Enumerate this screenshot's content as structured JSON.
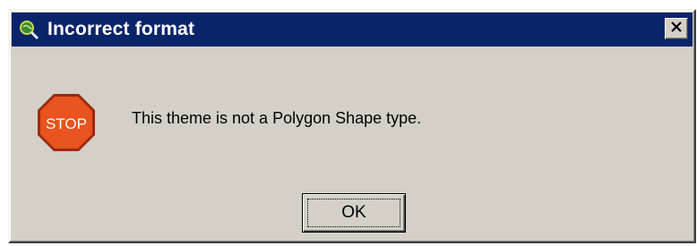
{
  "window": {
    "title": "Incorrect format",
    "app_icon": "magnifier-globe-icon",
    "close_icon": "close-icon"
  },
  "content": {
    "stop_icon_text": "STOP",
    "message": "This theme is not a Polygon Shape type."
  },
  "buttons": {
    "ok_label": "OK"
  },
  "colors": {
    "titlebar": "#0a246a",
    "dialog_face": "#d4d0c8",
    "stop_sign": "#e8531f"
  }
}
